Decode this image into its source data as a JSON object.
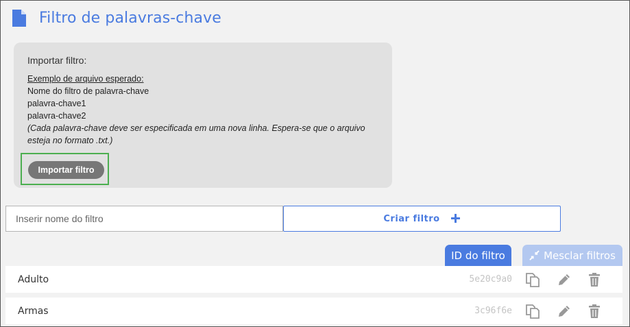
{
  "header": {
    "title": "Filtro de palavras-chave",
    "icon": "document-icon"
  },
  "import_panel": {
    "heading": "Importar filtro:",
    "example_title": "Exemplo de arquivo esperado:",
    "example_lines": [
      "Nome do filtro de palavra-chave",
      "palavra-chave1",
      "palavra-chave2"
    ],
    "note_line1": "(Cada palavra-chave deve ser especificada em uma nova linha. Espera-se que o arquivo",
    "note_line2": "esteja no formato .txt.)",
    "button_label": "Importar filtro"
  },
  "create": {
    "input_placeholder": "Inserir nome do filtro",
    "input_value": "",
    "button_label": "Criar filtro"
  },
  "tabs": {
    "id_label": "ID do filtro",
    "merge_label": "Mesclar filtros"
  },
  "filters": [
    {
      "name": "Adulto",
      "id": "5e20c9a0"
    },
    {
      "name": "Armas",
      "id": "3c96f6e"
    }
  ],
  "colors": {
    "accent": "#4a7be0",
    "accent_light": "#b3c8f0",
    "highlight": "#4caf50",
    "panel": "#e1e1e1"
  }
}
